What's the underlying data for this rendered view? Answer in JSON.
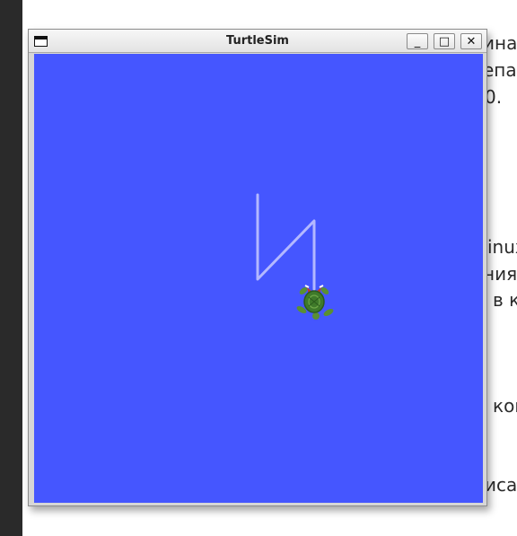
{
  "window": {
    "title": "TurtleSim",
    "minimize_label": "_",
    "maximize_label": "□",
    "close_label": "✕"
  },
  "colors": {
    "canvas": "#4556ff",
    "pen": "#b3b8ff",
    "turtle_shell": "#3f7a2a",
    "turtle_skin": "#5a8f33"
  },
  "icons": [
    "window-menu-icon",
    "minimize-icon",
    "maximize-icon",
    "close-icon",
    "turtle-icon"
  ],
  "background_text": [
    "ина",
    "епа",
    "0.",
    "inux",
    "ния",
    "в к",
    "ком",
    "иса"
  ]
}
